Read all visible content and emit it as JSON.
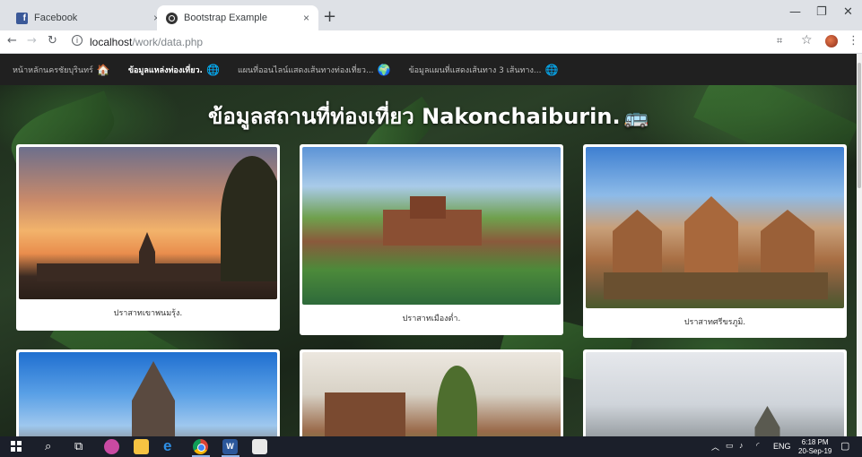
{
  "browser": {
    "tabs": [
      {
        "title": "Facebook",
        "favicon": "facebook-icon",
        "active": false
      },
      {
        "title": "Bootstrap Example",
        "favicon": "bootstrap-icon",
        "active": true
      }
    ],
    "new_tab": "+",
    "close_glyph": "×",
    "address": {
      "host": "localhost",
      "path": "/work/data.php"
    }
  },
  "site_nav": {
    "items": [
      {
        "label": "หน้าหลักนครชัยบุรินทร์",
        "emoji": "🏠",
        "active": false
      },
      {
        "label": "ข้อมูลแหล่งท่องเที่ยว.",
        "emoji": "🌐",
        "active": true
      },
      {
        "label": "แผนที่ออนไลน์แสดงเส้นทางท่องเที่ยว...",
        "emoji": "🌍",
        "active": false
      },
      {
        "label": "ข้อมูลแผนที่แสดงเส้นทาง 3 เส้นทาง...",
        "emoji": "🌐",
        "active": false
      }
    ]
  },
  "hero": {
    "title": "ข้อมูลสถานที่ท่องเที่ยว Nakonchaiburin.",
    "emoji": "🚌"
  },
  "cards": [
    {
      "caption": "ปราสาทเขาพนมรุ้ง."
    },
    {
      "caption": "ปราสาทเมืองต่ำ."
    },
    {
      "caption": "ปราสาทศรีขรภูมิ."
    },
    {
      "caption": ""
    },
    {
      "caption": ""
    },
    {
      "caption": ""
    }
  ],
  "taskbar": {
    "language": "ENG",
    "time": "6:18 PM",
    "date": "20-Sep-19"
  },
  "colors": {
    "navbar_bg": "#202020",
    "tabstrip_bg": "#dee1e6",
    "taskbar_bg": "#1b1f2a",
    "facebook_blue": "#3b5998"
  }
}
